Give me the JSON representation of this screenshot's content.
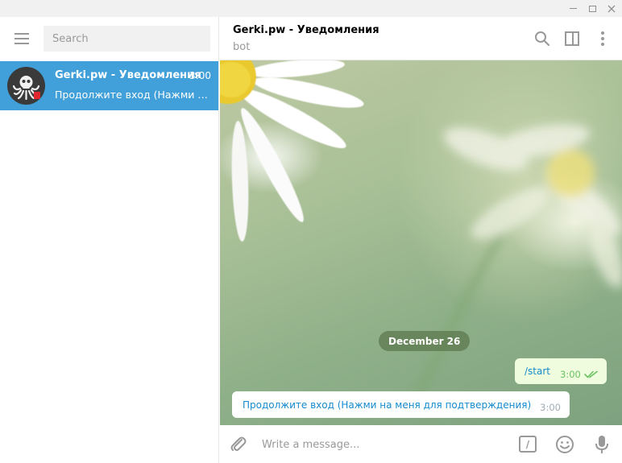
{
  "window": {
    "controls": [
      "minimize-icon",
      "maximize-icon",
      "close-icon"
    ]
  },
  "sidebar": {
    "search_placeholder": "Search",
    "dialogs": [
      {
        "name": "Gerki.pw - Уведомления",
        "time": "3:00",
        "preview": "Продолжите вход (Нажми на меня для подтверждения)",
        "selected": true
      }
    ]
  },
  "chat": {
    "peer_name": "Gerki.pw - Уведомления",
    "peer_status": "bot",
    "header_icons": [
      "search-icon",
      "sidebar-toggle-icon",
      "more-vertical-icon"
    ],
    "date_badge": "December 26",
    "messages": [
      {
        "direction": "out",
        "text": "/start",
        "time": "3:00",
        "status": "read"
      },
      {
        "direction": "in",
        "text": "Продолжите вход (Нажми на меня для подтверждения)",
        "time": "3:00"
      }
    ]
  },
  "composer": {
    "placeholder": "Write a message...",
    "command_glyph": "/",
    "icons": [
      "attach-icon",
      "bot-command-icon",
      "emoji-icon",
      "microphone-icon"
    ]
  },
  "colors": {
    "accent": "#419fd9",
    "link": "#168acd",
    "outgoing_bubble": "#effdde",
    "read_check": "#6cc264"
  }
}
